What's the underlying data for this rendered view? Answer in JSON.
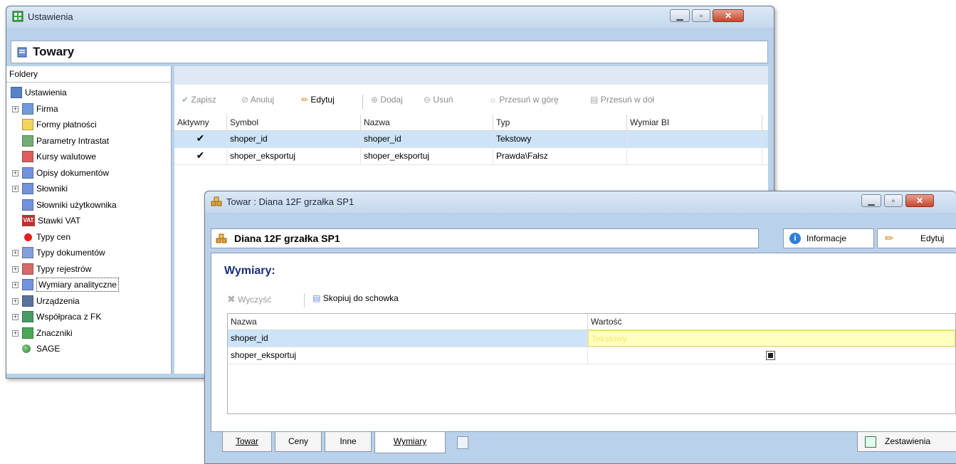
{
  "settings_window": {
    "title": "Ustawienia",
    "header_title": "Towary",
    "folders_label": "Foldery",
    "tree": [
      {
        "label": "Ustawienia",
        "icon": "wrench-settings-icon",
        "level": 0,
        "expander": false
      },
      {
        "label": "Firma",
        "icon": "company-icon",
        "level": 1,
        "expander": true
      },
      {
        "label": "Formy płatności",
        "icon": "folder-icon",
        "level": 1,
        "expander": false
      },
      {
        "label": "Parametry Intrastat",
        "icon": "intrastat-icon",
        "level": 1,
        "expander": false
      },
      {
        "label": "Kursy walutowe",
        "icon": "chart-icon",
        "level": 1,
        "expander": false
      },
      {
        "label": "Opisy dokumentów",
        "icon": "document-icon",
        "level": 1,
        "expander": true
      },
      {
        "label": "Słowniki",
        "icon": "document-icon",
        "level": 1,
        "expander": true
      },
      {
        "label": "Słowniki użytkownika",
        "icon": "document-icon",
        "level": 1,
        "expander": false
      },
      {
        "label": "Stawki VAT",
        "icon": "vat-icon",
        "level": 1,
        "expander": false
      },
      {
        "label": "Typy cen",
        "icon": "red-dot-icon",
        "level": 1,
        "expander": false
      },
      {
        "label": "Typy dokumentów",
        "icon": "documents-icon",
        "level": 1,
        "expander": true
      },
      {
        "label": "Typy rejestrów",
        "icon": "register-icon",
        "level": 1,
        "expander": true
      },
      {
        "label": "Wymiary analityczne",
        "icon": "document-icon",
        "level": 1,
        "expander": true,
        "selected": true
      },
      {
        "label": "Urządzenia",
        "icon": "printer-icon",
        "level": 1,
        "expander": true
      },
      {
        "label": "Współpraca z FK",
        "icon": "fk-icon",
        "level": 1,
        "expander": true
      },
      {
        "label": "Znaczniki",
        "icon": "tags-icon",
        "level": 1,
        "expander": true
      },
      {
        "label": "SAGE",
        "icon": "sage-icon",
        "level": 1,
        "expander": false
      }
    ],
    "toolbar": {
      "save": "Zapisz",
      "cancel": "Anuluj",
      "edit": "Edytuj",
      "add": "Dodaj",
      "remove": "Usuń",
      "move_up": "Przesuń w górę",
      "move_down": "Przesuń w dół"
    },
    "grid": {
      "columns": [
        "Aktywny",
        "Symbol",
        "Nazwa",
        "Typ",
        "Wymiar BI"
      ],
      "rows": [
        {
          "active": true,
          "symbol": "shoper_id",
          "name": "shoper_id",
          "type": "Tekstowy",
          "bi": "",
          "selected": true
        },
        {
          "active": true,
          "symbol": "shoper_eksportuj",
          "name": "shoper_eksportuj",
          "type": "Prawda\\Fałsz",
          "bi": "",
          "selected": false
        }
      ]
    }
  },
  "product_window": {
    "title": "Towar : Diana 12F grzałka SP1",
    "name_field": "Diana 12F grzałka SP1",
    "info_button": "Informacje",
    "edit_button": "Edytuj",
    "section_title": "Wymiary:",
    "toolbar": {
      "clear": "Wyczyść",
      "copy": "Skopiuj do schowka"
    },
    "grid": {
      "columns": [
        "Nazwa",
        "Wartość"
      ],
      "rows": [
        {
          "name": "shoper_id",
          "value": "Tekstowy",
          "selected": true
        },
        {
          "name": "shoper_eksportuj",
          "value": "",
          "checkbox": true,
          "selected": false
        }
      ]
    },
    "tabs": [
      "Towar",
      "Ceny",
      "Inne",
      "Wymiary"
    ],
    "active_tab": "Wymiary",
    "reports_button": "Zestawienia"
  },
  "colors": {
    "selection": "#cde3f7",
    "title_text": "#1a2f7a",
    "value_highlight": "#ffffc0"
  }
}
